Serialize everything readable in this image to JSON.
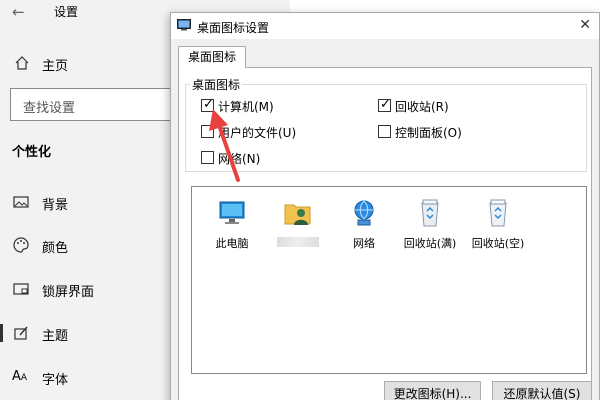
{
  "settings": {
    "title": "设置",
    "home_label": "主页",
    "search_placeholder": "查找设置",
    "section_title": "个性化",
    "items": [
      {
        "label": "背景",
        "icon": "picture-icon"
      },
      {
        "label": "颜色",
        "icon": "palette-icon"
      },
      {
        "label": "锁屏界面",
        "icon": "lock-screen-icon"
      },
      {
        "label": "主题",
        "icon": "theme-brush-icon"
      },
      {
        "label": "字体",
        "icon": "font-icon"
      }
    ]
  },
  "dialog": {
    "title": "桌面图标设置",
    "tab": "桌面图标",
    "group_label": "桌面图标",
    "checkboxes": [
      {
        "label": "计算机(M)",
        "checked": true
      },
      {
        "label": "回收站(R)",
        "checked": true
      },
      {
        "label": "用户的文件(U)",
        "checked": false
      },
      {
        "label": "控制面板(O)",
        "checked": false
      },
      {
        "label": "网络(N)",
        "checked": false
      }
    ],
    "icons": [
      {
        "label": "此电脑",
        "icon": "monitor-icon"
      },
      {
        "label": "",
        "icon": "user-folder-icon"
      },
      {
        "label": "网络",
        "icon": "network-globe-icon"
      },
      {
        "label": "回收站(满)",
        "icon": "recycle-bin-full-icon"
      },
      {
        "label": "回收站(空)",
        "icon": "recycle-bin-empty-icon"
      }
    ],
    "buttons": {
      "change_icon": "更改图标(H)...",
      "restore_default": "还原默认值(S)"
    }
  },
  "colors": {
    "arrow": "#e8413f",
    "settings_bg": "#f2f2f2",
    "dialog_bg": "#f0f0f0"
  }
}
